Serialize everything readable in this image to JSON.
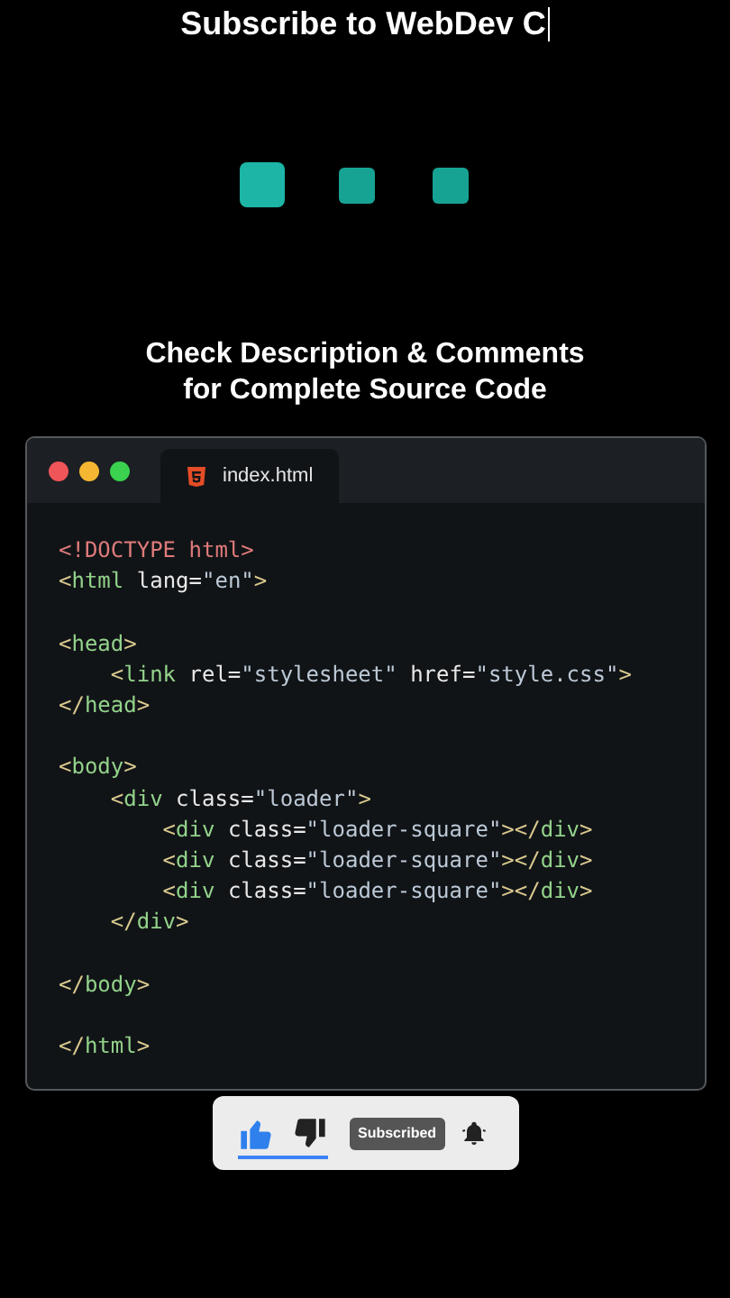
{
  "header": {
    "title": "Subscribe to WebDev C",
    "cursor_visible": true
  },
  "caption": [
    "Check Description & Comments",
    "for Complete Source Code"
  ],
  "editor": {
    "tab": {
      "label": "index.html",
      "selected": true
    },
    "lines": [
      {
        "kind": "code",
        "tokens": [
          {
            "kind": "doctype",
            "text": "<!DOCTYPE html>"
          }
        ]
      },
      {
        "kind": "code",
        "tokens": [
          {
            "kind": "punct",
            "text": "<"
          },
          {
            "kind": "tag",
            "text": "html"
          },
          {
            "kind": "attr",
            "text": " lang="
          },
          {
            "kind": "string",
            "text": "\"en\""
          },
          {
            "kind": "punct",
            "text": ">"
          }
        ]
      },
      {
        "kind": "blank"
      },
      {
        "kind": "code",
        "tokens": [
          {
            "kind": "punct",
            "text": "<"
          },
          {
            "kind": "tag",
            "text": "head"
          },
          {
            "kind": "punct",
            "text": ">"
          }
        ]
      },
      {
        "kind": "code",
        "tokens": [
          {
            "kind": "punct",
            "text": "    <"
          },
          {
            "kind": "tag",
            "text": "link"
          },
          {
            "kind": "attr",
            "text": " rel="
          },
          {
            "kind": "string",
            "text": "\"stylesheet\""
          },
          {
            "kind": "attr",
            "text": " href="
          },
          {
            "kind": "string",
            "text": "\"style.css\""
          },
          {
            "kind": "punct",
            "text": ">"
          }
        ]
      },
      {
        "kind": "code",
        "tokens": [
          {
            "kind": "punct",
            "text": "</"
          },
          {
            "kind": "tag",
            "text": "head"
          },
          {
            "kind": "punct",
            "text": ">"
          }
        ]
      },
      {
        "kind": "blank"
      },
      {
        "kind": "code",
        "tokens": [
          {
            "kind": "punct",
            "text": "<"
          },
          {
            "kind": "tag",
            "text": "body"
          },
          {
            "kind": "punct",
            "text": ">"
          }
        ]
      },
      {
        "kind": "code",
        "tokens": [
          {
            "kind": "punct",
            "text": "    <"
          },
          {
            "kind": "tag",
            "text": "div"
          },
          {
            "kind": "attr",
            "text": " class="
          },
          {
            "kind": "string",
            "text": "\"loader\""
          },
          {
            "kind": "punct",
            "text": ">"
          }
        ]
      },
      {
        "kind": "code",
        "tokens": [
          {
            "kind": "punct",
            "text": "        <"
          },
          {
            "kind": "tag",
            "text": "div"
          },
          {
            "kind": "attr",
            "text": " class="
          },
          {
            "kind": "string",
            "text": "\"loader-square\""
          },
          {
            "kind": "punct",
            "text": "></"
          },
          {
            "kind": "tag",
            "text": "div"
          },
          {
            "kind": "punct",
            "text": ">"
          }
        ]
      },
      {
        "kind": "code",
        "tokens": [
          {
            "kind": "punct",
            "text": "        <"
          },
          {
            "kind": "tag",
            "text": "div"
          },
          {
            "kind": "attr",
            "text": " class="
          },
          {
            "kind": "string",
            "text": "\"loader-square\""
          },
          {
            "kind": "punct",
            "text": "></"
          },
          {
            "kind": "tag",
            "text": "div"
          },
          {
            "kind": "punct",
            "text": ">"
          }
        ]
      },
      {
        "kind": "code",
        "tokens": [
          {
            "kind": "punct",
            "text": "        <"
          },
          {
            "kind": "tag",
            "text": "div"
          },
          {
            "kind": "attr",
            "text": " class="
          },
          {
            "kind": "string",
            "text": "\"loader-square\""
          },
          {
            "kind": "punct",
            "text": "></"
          },
          {
            "kind": "tag",
            "text": "div"
          },
          {
            "kind": "punct",
            "text": ">"
          }
        ]
      },
      {
        "kind": "code",
        "tokens": [
          {
            "kind": "punct",
            "text": "    </"
          },
          {
            "kind": "tag",
            "text": "div"
          },
          {
            "kind": "punct",
            "text": ">"
          }
        ]
      },
      {
        "kind": "blank"
      },
      {
        "kind": "code",
        "tokens": [
          {
            "kind": "punct",
            "text": "</"
          },
          {
            "kind": "tag",
            "text": "body"
          },
          {
            "kind": "punct",
            "text": ">"
          }
        ]
      },
      {
        "kind": "blank"
      },
      {
        "kind": "code",
        "tokens": [
          {
            "kind": "punct",
            "text": "</"
          },
          {
            "kind": "tag",
            "text": "html"
          },
          {
            "kind": "punct",
            "text": ">"
          }
        ]
      }
    ]
  },
  "subscribe_bar": {
    "like_selected": true,
    "dislike_selected": false,
    "subscribed_label": "Subscribed"
  }
}
